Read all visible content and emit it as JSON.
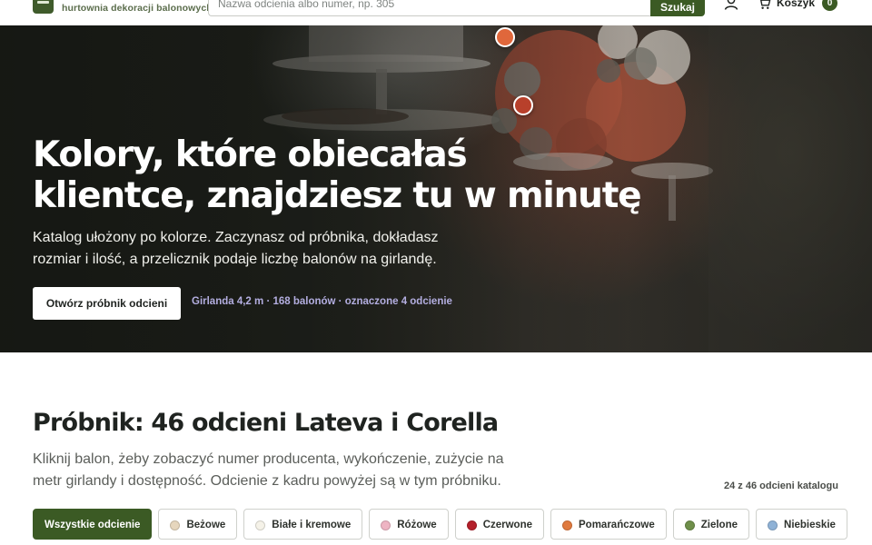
{
  "header": {
    "tagline": "hurtownia dekoracji balonowych",
    "search_placeholder": "Nazwa odcienia albo numer, np. 305",
    "search_button": "Szukaj",
    "user_icon": "user-icon",
    "cart_icon": "cart-icon",
    "cart_label": "Koszyk",
    "cart_count": "0"
  },
  "hero": {
    "title_line1": "Kolory, które obiecałaś",
    "title_line2": "klientce, znajdziesz tu w minutę",
    "subtitle_line1": "Katalog ułożony po kolorze. Zaczynasz od próbnika, dokładasz",
    "subtitle_line2": "rozmiar i ilość, a przelicznik podaje liczbę balonów na girlandę.",
    "cta_label": "Otwórz próbnik odcieni",
    "note": "Girlanda 4,2 m · 168 balonów · oznaczone 4 odcienie",
    "marker_colors": [
      "#e0673b",
      "#b8402b"
    ]
  },
  "catalog": {
    "title": "Próbnik: 46 odcieni Lateva i Corella",
    "desc_line1": "Kliknij balon, żeby zobaczyć numer producenta, wykończenie, zużycie na",
    "desc_line2": "metr girlandy i dostępność. Odcienie z kadru powyżej są w tym próbniku.",
    "count": "24 z 46 odcieni katalogu",
    "filters": [
      {
        "label": "Wszystkie odcienie",
        "color": null,
        "active": true
      },
      {
        "label": "Beżowe",
        "color": "#e6d6bd",
        "active": false
      },
      {
        "label": "Białe i kremowe",
        "color": "#f5f2e8",
        "active": false
      },
      {
        "label": "Różowe",
        "color": "#eeb4c3",
        "active": false
      },
      {
        "label": "Czerwone",
        "color": "#b4202b",
        "active": false
      },
      {
        "label": "Pomarańczowe",
        "color": "#e07a3e",
        "active": false
      },
      {
        "label": "Zielone",
        "color": "#6f8f4a",
        "active": false
      },
      {
        "label": "Niebieskie",
        "color": "#8fb2d6",
        "active": false
      }
    ]
  }
}
